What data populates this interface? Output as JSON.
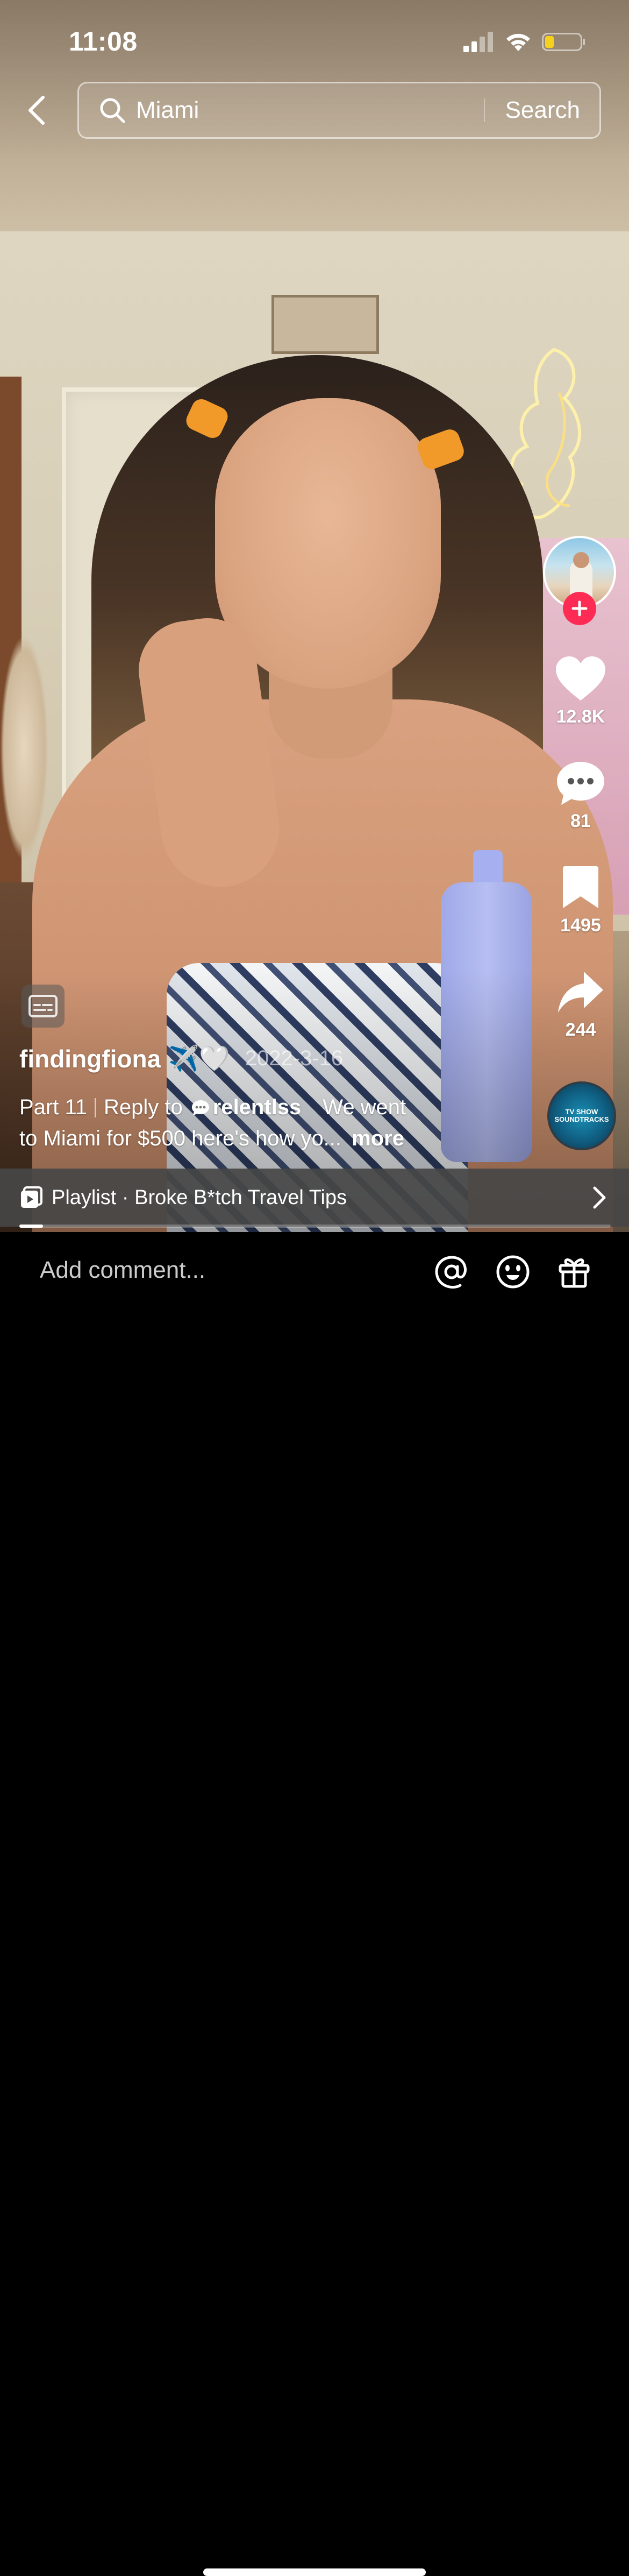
{
  "status_bar": {
    "time": "11:08",
    "icons": [
      "signal-icon",
      "wifi-icon",
      "battery-low-icon"
    ]
  },
  "search": {
    "query": "Miami",
    "button_label": "Search"
  },
  "actions": {
    "likes": "12.8K",
    "comments": "81",
    "saves": "1495",
    "shares": "244"
  },
  "sound": {
    "disc_label": "TV SHOW SOUNDTRACKS"
  },
  "post": {
    "username": "findingfiona",
    "username_emoji": "✈️🤍",
    "date": "2022-3-16",
    "caption_part": "Part 11",
    "reply_prefix": "Reply to",
    "reply_user": "relentlss",
    "caption_text_line1": "We went",
    "caption_text_line2": "to Miami for $500 here's how yo...",
    "more_label": "more"
  },
  "playlist": {
    "label": "Playlist · Broke B*tch Travel Tips",
    "progress": 0.04
  },
  "comment_bar": {
    "placeholder": "Add comment..."
  },
  "colors": {
    "follow_accent": "#fe2c55",
    "battery_level": "#f7d21c"
  }
}
